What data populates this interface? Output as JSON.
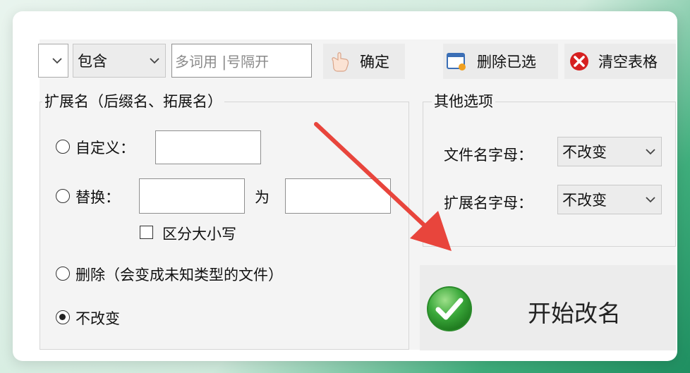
{
  "toolbar": {
    "match_mode": "包含",
    "keyword_placeholder": "多词用 |号隔开",
    "confirm_label": "确定",
    "delete_selected_label": "删除已选",
    "clear_table_label": "清空表格"
  },
  "extension_group": {
    "title": "扩展名（后缀名、拓展名）",
    "custom_label": "自定义：",
    "replace_label": "替换：",
    "replace_to_label": "为",
    "case_sensitive_label": "区分大小写",
    "delete_label": "删除（会变成未知类型的文件）",
    "unchanged_label": "不改变",
    "selected_option": "unchanged"
  },
  "other_options": {
    "title": "其他选项",
    "filename_case_label": "文件名字母：",
    "filename_case_value": "不改变",
    "ext_case_label": "扩展名字母：",
    "ext_case_value": "不改变"
  },
  "start_button": {
    "label": "开始改名"
  },
  "colors": {
    "annotation_arrow": "#e8453c",
    "check_green": "#2e9a2e",
    "clear_red": "#d62020"
  }
}
